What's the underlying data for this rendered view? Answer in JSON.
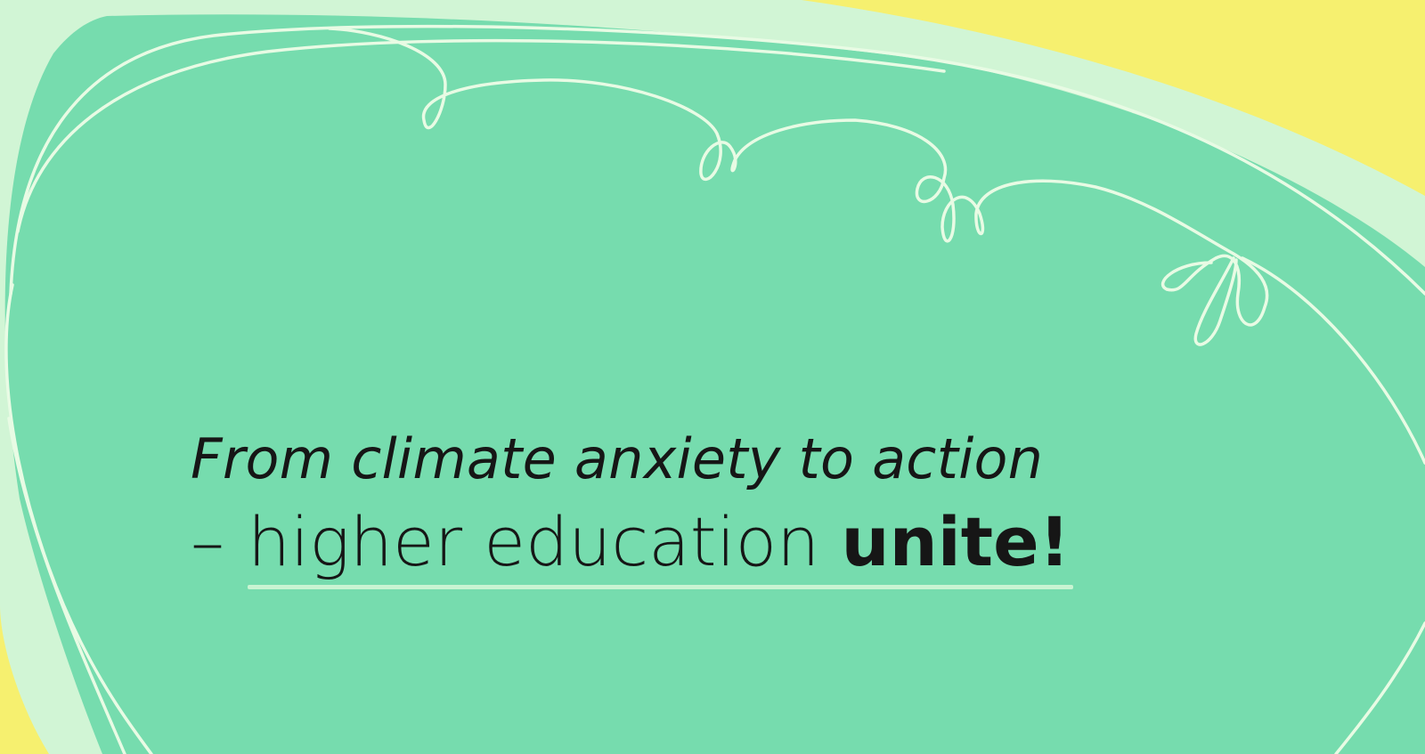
{
  "headline": {
    "line1": "From climate anxiety to action",
    "dash": "–",
    "line2_regular": "higher education",
    "line2_bold": "unite!"
  },
  "colors": {
    "yellow": "#f6f06f",
    "pale_green": "#d1f5d5",
    "green": "#76dcae",
    "line": "#e8fbe4",
    "text": "#161616"
  },
  "decorations": [
    "doodle-vine",
    "outline-loops"
  ]
}
